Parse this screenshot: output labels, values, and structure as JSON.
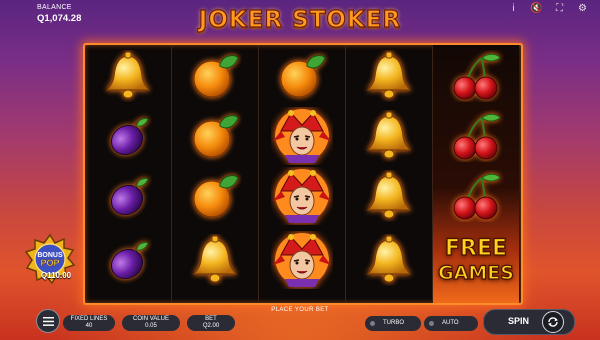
{
  "balance": {
    "label": "BALANCE",
    "value": "Q1,074.28"
  },
  "title": "JOKER STOKER",
  "top_icons": [
    "info-icon",
    "sound-off-icon",
    "fullscreen-icon",
    "settings-icon"
  ],
  "reels": [
    [
      "bell",
      "plum",
      "plum",
      "plum"
    ],
    [
      "orange",
      "orange",
      "orange",
      "bell"
    ],
    [
      "orange",
      "joker",
      "joker",
      "joker"
    ],
    [
      "bell",
      "bell",
      "bell",
      "bell"
    ],
    [
      "cherries",
      "cherries",
      "cherries",
      "free-games"
    ]
  ],
  "free_games": {
    "line1": "FREE",
    "line2": "GAMES"
  },
  "bonus_pop": {
    "line1": "BONUS",
    "line2": "POP",
    "amount": "Q110.00"
  },
  "bottom": {
    "place_bet": "PLACE YOUR BET",
    "fixed_lines": {
      "label": "FIXED LINES",
      "value": "40"
    },
    "coin_value": {
      "label": "COIN VALUE",
      "value": "0.05"
    },
    "bet": {
      "label": "BET",
      "value": "Q2.00"
    },
    "turbo": "TURBO",
    "auto": "AUTO",
    "spin": "SPIN"
  },
  "colors": {
    "frame": "#ff8b2a",
    "title": "#ff9a1e",
    "bar": "#2a2b34"
  }
}
